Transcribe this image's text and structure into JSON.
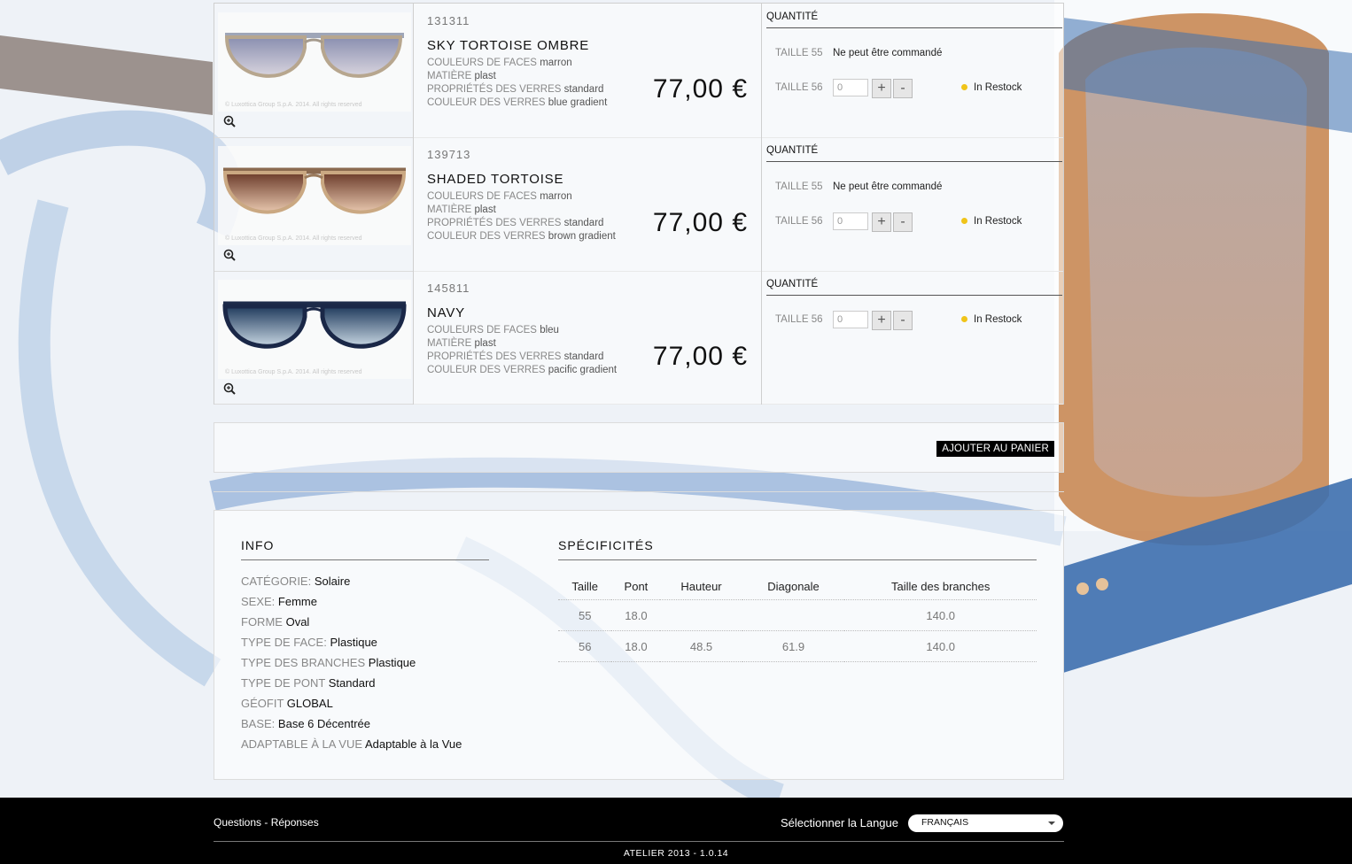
{
  "products": [
    {
      "sku": "131311",
      "name": "SKY TORTOISE OMBRE",
      "copyright": "© Luxottica Group S.p.A. 2014. All rights reserved",
      "attributes": [
        {
          "label": "COULEURS DE FACES",
          "value": "marron"
        },
        {
          "label": "MATIÈRE",
          "value": "plast"
        },
        {
          "label": "PROPRIÉTÉS DES VERRES",
          "value": "standard"
        },
        {
          "label": "COULEUR DES VERRES",
          "value": "blue gradient"
        }
      ],
      "price": "77,00 €",
      "quantity_header": "QUANTITÉ",
      "size55_label": "TAILLE 55",
      "size55_status": "Ne peut être commandé",
      "size56_label": "TAILLE 56",
      "size56_qty": "0",
      "size56_stock": "In Restock"
    },
    {
      "sku": "139713",
      "name": "SHADED TORTOISE",
      "copyright": "© Luxottica Group S.p.A. 2014. All rights reserved",
      "attributes": [
        {
          "label": "COULEURS DE FACES",
          "value": "marron"
        },
        {
          "label": "MATIÈRE",
          "value": "plast"
        },
        {
          "label": "PROPRIÉTÉS DES VERRES",
          "value": "standard"
        },
        {
          "label": "COULEUR DES VERRES",
          "value": "brown gradient"
        }
      ],
      "price": "77,00 €",
      "quantity_header": "QUANTITÉ",
      "size55_label": "TAILLE 55",
      "size55_status": "Ne peut être commandé",
      "size56_label": "TAILLE 56",
      "size56_qty": "0",
      "size56_stock": "In Restock"
    },
    {
      "sku": "145811",
      "name": "NAVY",
      "copyright": "© Luxottica Group S.p.A. 2014. All rights reserved",
      "attributes": [
        {
          "label": "COULEURS DE FACES",
          "value": "bleu"
        },
        {
          "label": "MATIÈRE",
          "value": "plast"
        },
        {
          "label": "PROPRIÉTÉS DES VERRES",
          "value": "standard"
        },
        {
          "label": "COULEUR DES VERRES",
          "value": "pacific gradient"
        }
      ],
      "price": "77,00 €",
      "quantity_header": "QUANTITÉ",
      "size56_label": "TAILLE 56",
      "size56_qty": "0",
      "size56_stock": "In Restock"
    }
  ],
  "qty_buttons": {
    "plus": "+",
    "minus": "-"
  },
  "icons": {
    "zoom": "zoom-in-icon",
    "stock_dot": "status-dot-icon"
  },
  "colors": {
    "stock_dot": "#f0c419",
    "footer_bg": "#000000",
    "cart_button_bg": "#000000"
  },
  "cart": {
    "add_label": "AJOUTER AU PANIER"
  },
  "info": {
    "title": "INFO",
    "items": [
      {
        "key": "CATÉGORIE:",
        "value": "Solaire"
      },
      {
        "key": "SEXE:",
        "value": "Femme"
      },
      {
        "key": "FORME",
        "value": "Oval"
      },
      {
        "key": "TYPE DE FACE:",
        "value": "Plastique"
      },
      {
        "key": "TYPE DES BRANCHES",
        "value": "Plastique"
      },
      {
        "key": "TYPE DE PONT",
        "value": "Standard"
      },
      {
        "key": "GÉOFIT",
        "value": "GLOBAL"
      },
      {
        "key": "BASE:",
        "value": "Base 6 Décentrée"
      },
      {
        "key": "ADAPTABLE À LA VUE",
        "value": "Adaptable à la Vue"
      }
    ]
  },
  "specs": {
    "title": "SPÉCIFICITÉS",
    "columns": [
      "Taille",
      "Pont",
      "Hauteur",
      "Diagonale",
      "Taille des branches"
    ],
    "rows": [
      [
        "55",
        "18.0",
        "",
        "",
        "140.0"
      ],
      [
        "56",
        "18.0",
        "48.5",
        "61.9",
        "140.0"
      ]
    ]
  },
  "footer": {
    "faq_label": "Questions - Réponses",
    "language_label": "Sélectionner la Langue",
    "language_value": "FRANÇAIS",
    "version": "ATELIER 2013 - 1.0.14"
  }
}
